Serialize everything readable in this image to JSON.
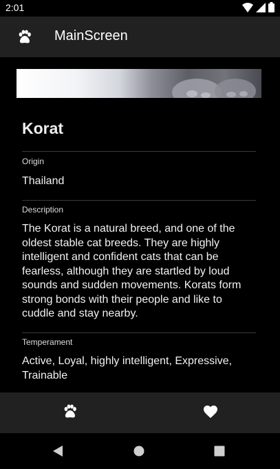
{
  "status_bar": {
    "time": "2:01",
    "icons": [
      "wifi-icon",
      "signal-icon",
      "battery-icon"
    ]
  },
  "app_bar": {
    "title": "MainScreen",
    "icon": "paw-icon"
  },
  "breed": {
    "name": "Korat",
    "origin_label": "Origin",
    "origin": "Thailand",
    "description_label": "Description",
    "description": "The Korat is a natural breed, and one of the oldest stable cat breeds. They are highly intelligent and confident cats that can be fearless, although they are startled by loud sounds and sudden movements. Korats form strong bonds with their people and like to cuddle and stay nearby.",
    "temperament_label": "Temperament",
    "temperament": "Active, Loyal, highly intelligent, Expressive, Trainable"
  },
  "bottom_nav": {
    "items": [
      {
        "icon": "paw-icon"
      },
      {
        "icon": "heart-icon"
      }
    ]
  },
  "system_nav": [
    "back-icon",
    "home-icon",
    "recents-icon"
  ],
  "colors": {
    "background": "#000000",
    "bar": "#212121",
    "divider": "#3a3a3a",
    "text": "#ffffff"
  }
}
